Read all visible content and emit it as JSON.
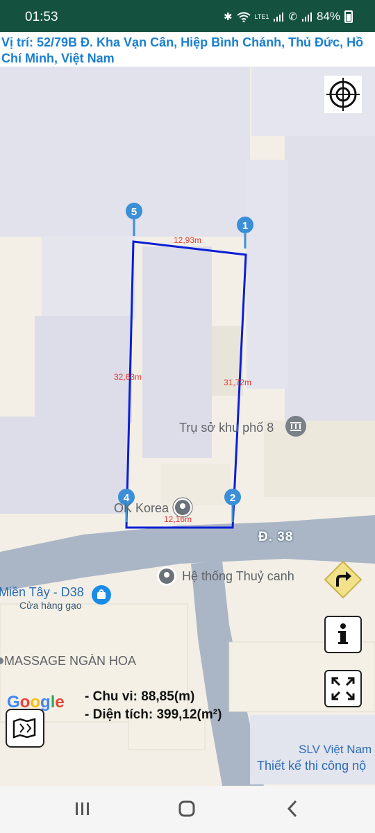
{
  "status": {
    "time": "01:53",
    "net_label": "LTE1",
    "battery": "84%"
  },
  "location": {
    "text": " Vị trí: 52/79B Đ. Kha Vạn Cân, Hiệp Bình Chánh, Thủ Đức, Hồ Chí Minh, Việt Nam"
  },
  "map": {
    "markers": [
      "1",
      "2",
      "4",
      "5"
    ],
    "edges": [
      "12,93m",
      "32,63m",
      "31,72m",
      "12,16m"
    ],
    "poi": {
      "tru_so": "Trụ sở khu phố 8",
      "korea": "OK Korea",
      "thuy_canh": "Hệ thống Thuỷ canh",
      "mien_tay": "Miền Tây - D38",
      "cua_hang": "Cửa hàng gạo",
      "massage": "MASSAGE NGÀN HOA",
      "slv": "SLV Việt Nam",
      "thiet_ke": "Thiết kế thi công nộ"
    },
    "road": "Đ. 38",
    "attribution": "Google"
  },
  "controls": {
    "locate_icon": "crosshair-icon",
    "route_icon": "turn-right-icon",
    "info_icon": "info-icon",
    "expand_icon": "fullscreen-icon",
    "layers_icon": "map-layers-icon"
  },
  "stats": {
    "perimeter": "- Chu vi: 88,85(m)",
    "area": "- Diện tích: 399,12(m²)"
  },
  "colors": {
    "status_bar": "#14523f",
    "polygon": "#0a1fd6",
    "marker": "#3b8fd6",
    "address": "#1a7fd0"
  }
}
